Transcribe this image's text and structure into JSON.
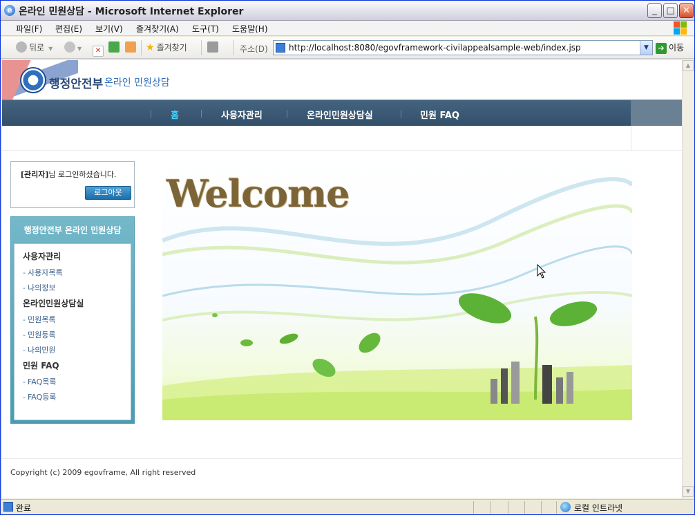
{
  "window": {
    "title": "온라인 민원상담 - Microsoft Internet Explorer",
    "minimize": "_",
    "maximize": "□",
    "close": "✕"
  },
  "menubar": {
    "items": [
      "파일(F)",
      "편집(E)",
      "보기(V)",
      "즐겨찾기(A)",
      "도구(T)",
      "도움말(H)"
    ]
  },
  "toolbar": {
    "back_label": "뒤로",
    "favorites_label": "즐겨찾기",
    "address_label": "주소(D)",
    "url": "http://localhost:8080/egovframework-civilappealsample-web/index.jsp",
    "go_label": "이동"
  },
  "site": {
    "logo_text": "행정안전부",
    "logo_sub": "온라인 민원상담",
    "nav": [
      "홈",
      "사용자관리",
      "온라인민원상담실",
      "민원 FAQ"
    ],
    "login": {
      "role": "[관리자]",
      "message": "님 로그인하셨습니다.",
      "logout_label": "로그아웃"
    },
    "leftmenu": {
      "title": "행정안전부 온라인 민원상담",
      "groups": [
        {
          "label": "사용자관리",
          "links": [
            "사용자목록",
            "나의정보"
          ]
        },
        {
          "label": "온라인민원상담실",
          "links": [
            "민원목록",
            "민원등록",
            "나의민원"
          ]
        },
        {
          "label": "민원 FAQ",
          "links": [
            "FAQ목록",
            "FAQ등록"
          ]
        }
      ]
    },
    "banner_text": "Welcome",
    "copyright": "Copyright (c) 2009 egovframe, All right reserved"
  },
  "statusbar": {
    "status": "완료",
    "zone": "로컬 인트라넷"
  },
  "colors": {
    "nav_bg": "#3b5873",
    "nav_active": "#40d2ff",
    "leftmenu_bg": "#5aa7bb",
    "logout_btn": "#2a7ab5"
  }
}
